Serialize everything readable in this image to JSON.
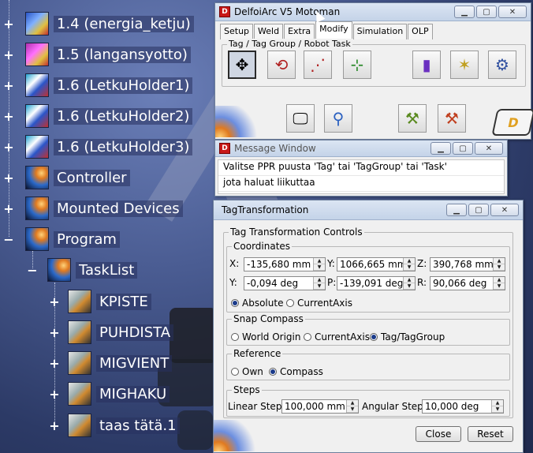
{
  "tree": {
    "items": [
      {
        "label": "1.4 (energia_ketju)",
        "icon": "robot-resource-icon",
        "toggle": "+"
      },
      {
        "label": "1.5 (langansyotto)",
        "icon": "robot-resource-icon",
        "toggle": "+"
      },
      {
        "label": "1.6 (LetkuHolder1)",
        "icon": "holder-resource-icon",
        "toggle": "+"
      },
      {
        "label": "1.6 (LetkuHolder2)",
        "icon": "holder-resource-icon",
        "toggle": "+"
      },
      {
        "label": "1.6 (LetkuHolder3)",
        "icon": "holder-resource-icon",
        "toggle": "+"
      },
      {
        "label": "Controller",
        "icon": "controller-icon",
        "toggle": "+"
      },
      {
        "label": "Mounted Devices",
        "icon": "mounted-devices-icon",
        "toggle": "+"
      },
      {
        "label": "Program",
        "icon": "program-icon",
        "toggle": "−"
      },
      {
        "label": "TaskList",
        "icon": "tasklist-icon",
        "toggle": "−"
      },
      {
        "label": "KPISTE",
        "icon": "task-icon",
        "toggle": "+"
      },
      {
        "label": "PUHDISTA",
        "icon": "task-icon",
        "toggle": "+"
      },
      {
        "label": "MIGVIENT",
        "icon": "task-icon",
        "toggle": "+"
      },
      {
        "label": "MIGHAKU",
        "icon": "task-icon",
        "toggle": "+"
      },
      {
        "label": "taas tätä.1",
        "icon": "task-icon",
        "toggle": "+"
      }
    ]
  },
  "motoman": {
    "title": "DelfoiArc V5 Motoman",
    "tabs": [
      "Setup",
      "Weld",
      "Extra",
      "Modify",
      "Simulation",
      "OLP"
    ],
    "active_tab": "Modify",
    "group_label": "Tag / Tag Group / Robot Task"
  },
  "message": {
    "title": "Message Window",
    "lines": [
      "Valitse PPR puusta 'Tag' tai 'TagGroup' tai 'Task'",
      "jota haluat liikuttaa"
    ]
  },
  "tagtrans": {
    "title": "TagTransformation",
    "controls_legend": "Tag Transformation Controls",
    "coords_legend": "Coordinates",
    "x_label": "X:",
    "x_value": "-135,680 mm",
    "y_label": "Y:",
    "y_value": "1066,665 mm",
    "z_label": "Z:",
    "z_value": "390,768 mm",
    "yaw_label": "Y:",
    "yaw_value": "-0,094 deg",
    "pitch_label": "P:",
    "pitch_value": "-139,091 deg",
    "roll_label": "R:",
    "roll_value": "90,066 deg",
    "absolute_label": "Absolute",
    "currentaxis_label": "CurrentAxis",
    "snap_legend": "Snap Compass",
    "snap_world": "World Origin",
    "snap_currentaxis": "CurrentAxis",
    "snap_tag": "Tag/TagGroup",
    "reference_legend": "Reference",
    "ref_own": "Own",
    "ref_compass": "Compass",
    "steps_legend": "Steps",
    "linear_label": "Linear Step :",
    "linear_value": "100,000 mm",
    "angular_label": "Angular Step :",
    "angular_value": "10,000 deg",
    "close_label": "Close",
    "reset_label": "Reset"
  },
  "colors": {
    "accent": "#2a55c8",
    "tree_text": "#ffffff",
    "title_icon": "#c81818"
  }
}
